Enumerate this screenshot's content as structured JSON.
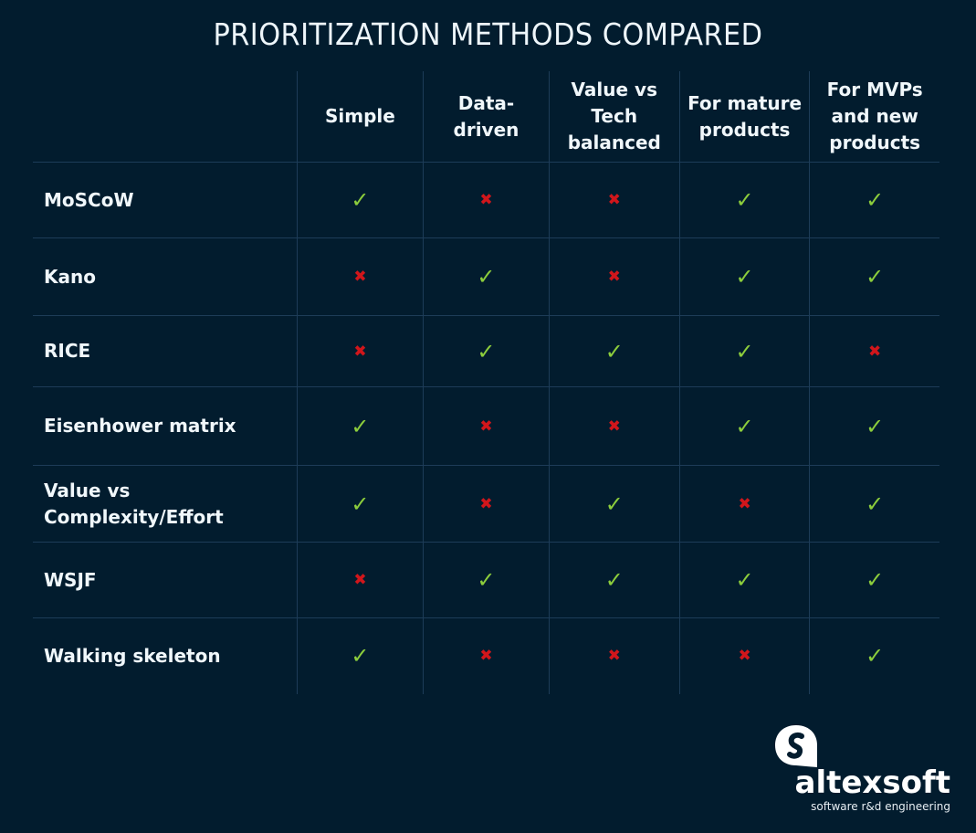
{
  "title": "PRIORITIZATION METHODS COMPARED",
  "columns": [
    "Simple",
    "Data-\ndriven",
    "Value vs\nTech\nbalanced",
    "For mature\nproducts",
    "For MVPs\nand new\nproducts"
  ],
  "rows": [
    {
      "method": "MoSCoW",
      "values": [
        true,
        false,
        false,
        true,
        true
      ]
    },
    {
      "method": "Kano",
      "values": [
        false,
        true,
        false,
        true,
        true
      ]
    },
    {
      "method": "RICE",
      "values": [
        false,
        true,
        true,
        true,
        false
      ]
    },
    {
      "method": "Eisenhower matrix",
      "values": [
        true,
        false,
        false,
        true,
        true
      ]
    },
    {
      "method": "Value vs\nComplexity/Effort",
      "values": [
        true,
        false,
        true,
        false,
        true
      ]
    },
    {
      "method": "WSJF",
      "values": [
        false,
        true,
        true,
        true,
        true
      ]
    },
    {
      "method": "Walking skeleton",
      "values": [
        true,
        false,
        false,
        false,
        true
      ]
    }
  ],
  "icons": {
    "yes": "checkmark-icon",
    "no": "cross-icon",
    "yes_glyph": "✓",
    "no_glyph": "✖"
  },
  "colors": {
    "background": "#021c2e",
    "check": "#8ccd3c",
    "cross": "#d1161b",
    "grid": "#1d3c58"
  },
  "brand": {
    "name": "altexsoft",
    "tagline": "software r&d engineering"
  }
}
